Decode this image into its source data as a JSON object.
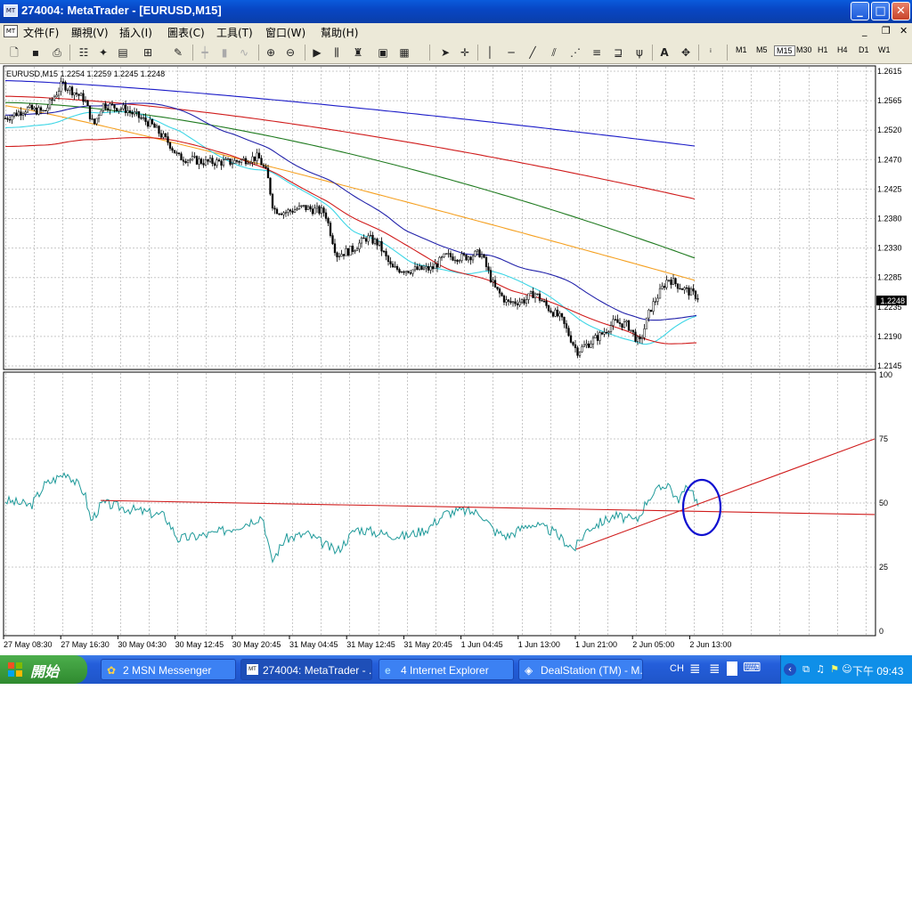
{
  "window": {
    "title": "274004: MetaTrader - [EURUSD,M15]",
    "icon_text": "MT"
  },
  "menu": {
    "items": [
      "文件(F)",
      "顯視(V)",
      "插入(I)",
      "圖表(C)",
      "工具(T)",
      "窗口(W)",
      "幫助(H)"
    ]
  },
  "toolbar": {
    "timeframes": [
      "M1",
      "M5",
      "M15",
      "M30",
      "H1",
      "H4",
      "D1",
      "W1"
    ],
    "active_timeframe": "M15"
  },
  "chart_data": [
    {
      "type": "candlestick",
      "title": "EURUSD,M15  1.2254 1.2259 1.2245 1.2248",
      "current_price_label": "1.2248",
      "y_ticks": [
        "1.2615",
        "1.2565",
        "1.2520",
        "1.2470",
        "1.2425",
        "1.2380",
        "1.2330",
        "1.2285",
        "1.2235",
        "1.2190",
        "1.2145"
      ],
      "ylim": [
        1.2145,
        1.2615
      ],
      "grid": true,
      "moving_averages_end_values": {
        "blue_long": 1.2495,
        "red_long": 1.241,
        "green": 1.2315,
        "orange": 1.228,
        "navy_short": 1.2236,
        "cyan": 1.2228,
        "red_short": 1.216
      },
      "colors": {
        "candles": "#000000",
        "ma_blue_long": "#1c1cc8",
        "ma_red_long": "#d01c1c",
        "ma_green": "#1f7a1f",
        "ma_orange": "#f5a020",
        "ma_navy": "#2222aa",
        "ma_cyan": "#3ed6e6",
        "ma_red_short": "#d01c1c"
      }
    },
    {
      "type": "line",
      "y_ticks": [
        "100",
        "75",
        "50",
        "25",
        "0"
      ],
      "ylim": [
        0,
        100
      ],
      "grid": true,
      "trendlines": [
        {
          "desc": "horizontal",
          "from": [
            51,
            "27 May 16:30"
          ],
          "to": [
            46,
            "2 Jun 13:00+"
          ]
        },
        {
          "desc": "rising",
          "from": [
            32,
            "1 Jun 21:00"
          ],
          "to": [
            75,
            "end"
          ]
        }
      ],
      "highlight_ellipse": "around 2 Jun 13:00 near 50",
      "colors": {
        "oscillator": "#1f9a9a",
        "trendline": "#d01c1c",
        "ellipse": "#1010d0"
      }
    }
  ],
  "x_axis_labels": [
    "27 May 08:30",
    "27 May 16:30",
    "30 May 04:30",
    "30 May 12:45",
    "30 May 20:45",
    "31 May 04:45",
    "31 May 12:45",
    "31 May 20:45",
    "1 Jun 04:45",
    "1 Jun 13:00",
    "1 Jun 21:00",
    "2 Jun 05:00",
    "2 Jun 13:00"
  ],
  "taskbar": {
    "start_label": "開始",
    "tasks": [
      {
        "label": "2 MSN Messenger"
      },
      {
        "label": "274004: MetaTrader - ..."
      },
      {
        "label": "4 Internet Explorer"
      },
      {
        "label": "DealStation (TM) - M..."
      }
    ],
    "lang": "CH",
    "clock": "下午 09:43"
  }
}
